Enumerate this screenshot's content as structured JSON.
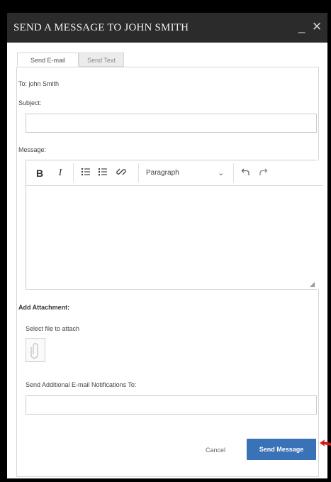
{
  "dialog": {
    "title": "SEND A MESSAGE TO JOHN SMITH",
    "minimize_glyph": "_",
    "close_glyph": "✕"
  },
  "tabs": [
    {
      "label": "Send E-mail",
      "active": true
    },
    {
      "label": "Send Text",
      "active": false
    }
  ],
  "form": {
    "to_label": "To: john Smith",
    "subject_label": "Subject:",
    "subject_value": "",
    "subject_placeholder": "",
    "message_label": "Message:",
    "attachment_label": "Add Attachment:",
    "select_file_label": "Select file to attach",
    "notifications_label": "Send Additional E-mail Notifications To:",
    "notifications_value": "",
    "notifications_placeholder": ""
  },
  "editor": {
    "bold_label": "B",
    "italic_label": "I",
    "paragraph_value": "Paragraph",
    "icons": [
      "bold-icon",
      "italic-icon",
      "bulleted-list-icon",
      "numbered-list-icon",
      "link-icon",
      "undo-icon",
      "redo-icon"
    ]
  },
  "actions": {
    "cancel_label": "Cancel",
    "send_label": "Send Message"
  },
  "colors": {
    "titlebar": "#2b2b2b",
    "primary_button": "#3a72b8",
    "annotation_arrow": "#d21a1a"
  }
}
